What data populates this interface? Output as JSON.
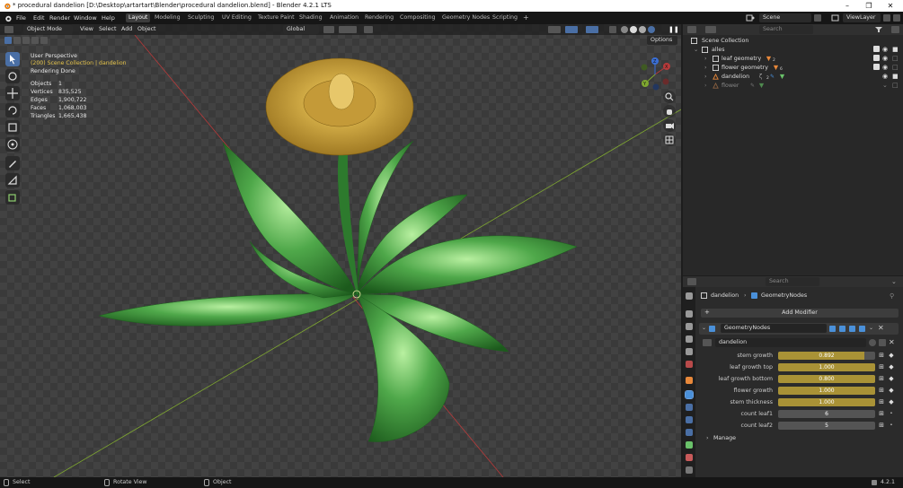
{
  "window": {
    "title": "* procedural dandelion [D:\\Desktop\\artartart\\Blender\\procedural dandelion.blend] - Blender 4.2.1 LTS",
    "minimize": "–",
    "maximize": "❐",
    "close": "✕"
  },
  "menubar": {
    "menus": [
      "File",
      "Edit",
      "Render",
      "Window",
      "Help"
    ],
    "workspaces": [
      "Layout",
      "Modeling",
      "Sculpting",
      "UV Editing",
      "Texture Paint",
      "Shading",
      "Animation",
      "Rendering",
      "Compositing",
      "Geometry Nodes",
      "Scripting"
    ],
    "active_workspace": "Layout",
    "add_workspace": "+",
    "scene": "Scene",
    "view_layer": "ViewLayer"
  },
  "viewport": {
    "mode": "Object Mode",
    "menus": [
      "View",
      "Select",
      "Add",
      "Object"
    ],
    "orientation": "Global",
    "options": "Options",
    "overlay": {
      "perspective": "User Perspective",
      "collection": "(200) Scene Collection | dandelion",
      "status": "Rendering Done"
    },
    "stats": [
      {
        "label": "Objects",
        "value": "1"
      },
      {
        "label": "Vertices",
        "value": "835,525"
      },
      {
        "label": "Edges",
        "value": "1,900,722"
      },
      {
        "label": "Faces",
        "value": "1,068,003"
      },
      {
        "label": "Triangles",
        "value": "1,665,438"
      }
    ],
    "gizmo": {
      "x": "X",
      "y": "Y",
      "z": "Z"
    }
  },
  "outliner": {
    "search_placeholder": "Search",
    "root": "Scene Collection",
    "items": [
      {
        "label": "alles",
        "depth": 1,
        "kind": "collection"
      },
      {
        "label": "leaf geometry",
        "depth": 2,
        "kind": "object",
        "badge": "2"
      },
      {
        "label": "flower geometry",
        "depth": 2,
        "kind": "object",
        "badge": "6"
      },
      {
        "label": "dandelion",
        "depth": 2,
        "kind": "object",
        "badge": "2"
      },
      {
        "label": "flower",
        "depth": 2,
        "kind": "object",
        "badge": ""
      }
    ]
  },
  "properties": {
    "search_placeholder": "Search",
    "breadcrumb_object": "dandelion",
    "breadcrumb_modifier": "GeometryNodes",
    "add_modifier": "Add Modifier",
    "modifier_name": "GeometryNodes",
    "node_group": "dandelion",
    "inputs": [
      {
        "label": "stem growth",
        "value": "0.892",
        "fraction": 0.892
      },
      {
        "label": "leaf growth top",
        "value": "1.000",
        "fraction": 1.0
      },
      {
        "label": "leaf growth bottom",
        "value": "0.800",
        "fraction": 1.0
      },
      {
        "label": "flower growth",
        "value": "1.000",
        "fraction": 1.0
      },
      {
        "label": "stem thickness",
        "value": "1.000",
        "fraction": 1.0
      },
      {
        "label": "count leaf1",
        "value": "6",
        "fraction": 0
      },
      {
        "label": "count leaf2",
        "value": "5",
        "fraction": 0
      }
    ],
    "manage": "Manage"
  },
  "statusbar": {
    "select": "Select",
    "rotate": "Rotate View",
    "object": "Object",
    "version": "4.2.1"
  },
  "colors": {
    "accent_blue": "#4a6fa5",
    "slider_gold": "#a99236",
    "axis_red": "#b83a3a",
    "axis_green": "#7fa830"
  }
}
